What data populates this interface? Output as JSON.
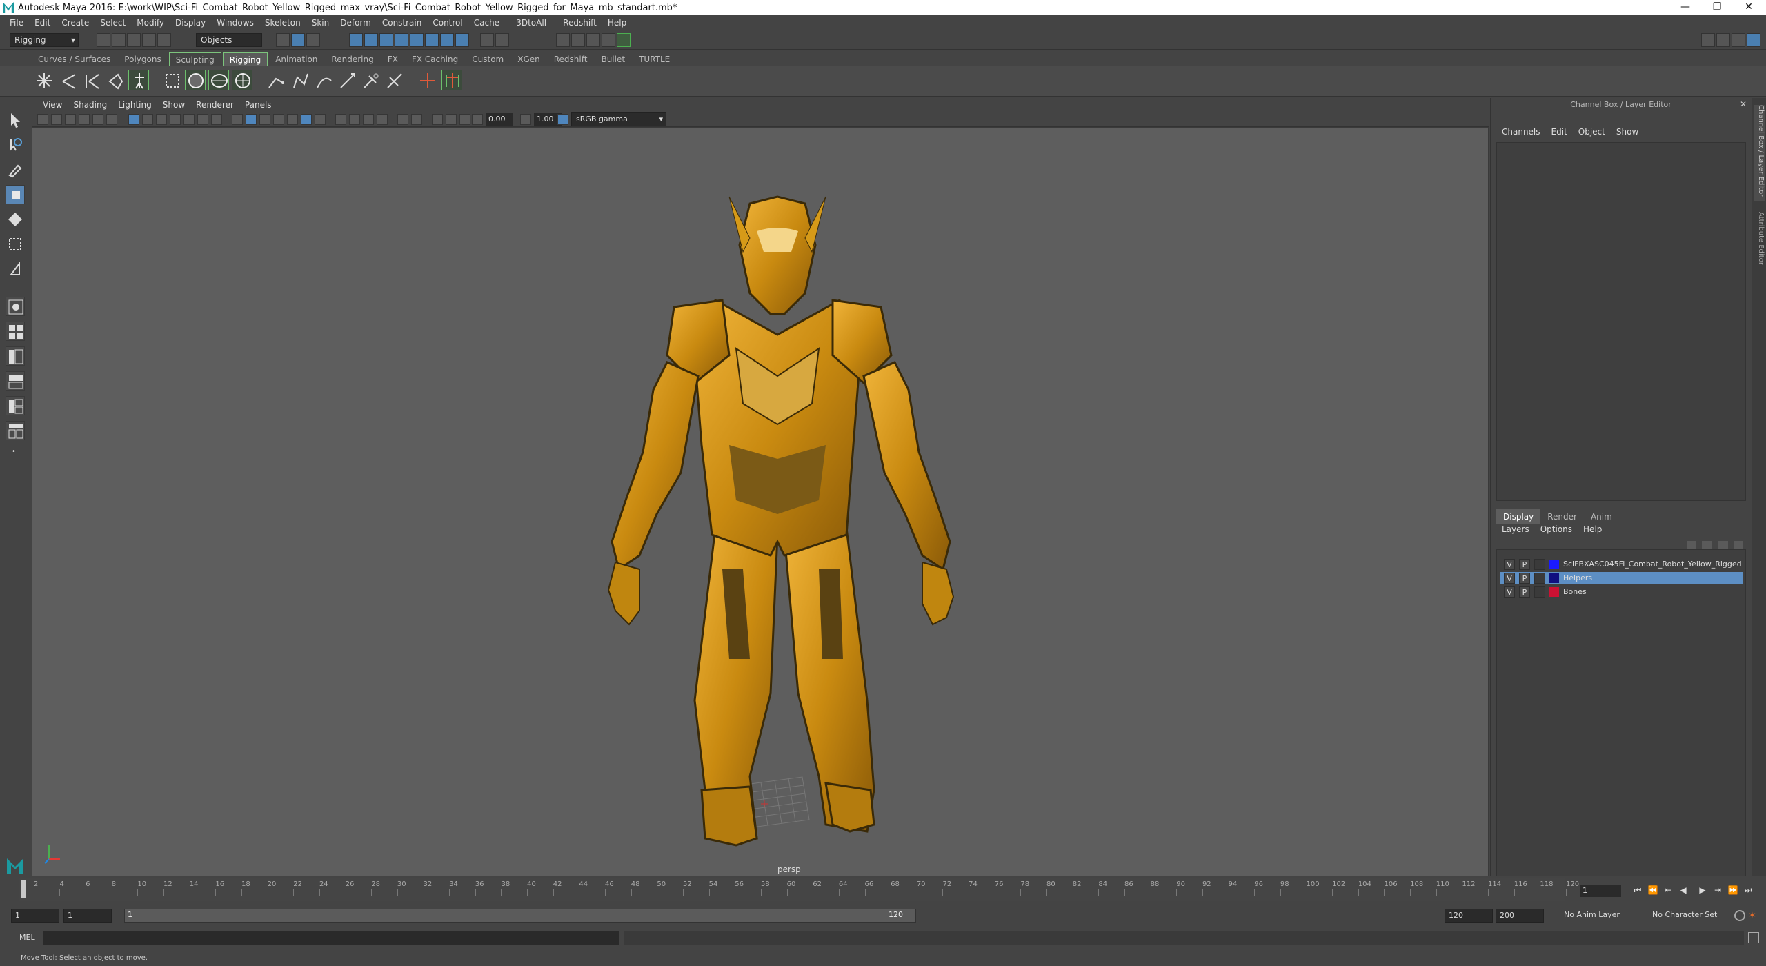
{
  "titlebar": {
    "title": "Autodesk Maya 2016: E:\\work\\WIP\\Sci-Fi_Combat_Robot_Yellow_Rigged_max_vray\\Sci-Fi_Combat_Robot_Yellow_Rigged_for_Maya_mb_standart.mb*",
    "min": "—",
    "restore": "❐",
    "close": "✕"
  },
  "menubar": [
    "File",
    "Edit",
    "Create",
    "Select",
    "Modify",
    "Display",
    "Windows",
    "Skeleton",
    "Skin",
    "Deform",
    "Constrain",
    "Control",
    "Cache",
    "- 3DtoAll -",
    "Redshift",
    "Help"
  ],
  "statusline": {
    "menuset": "Rigging",
    "selmode": "Objects"
  },
  "shelf_tabs": [
    "Curves / Surfaces",
    "Polygons",
    "Sculpting",
    "Rigging",
    "Animation",
    "Rendering",
    "FX",
    "FX Caching",
    "Custom",
    "XGen",
    "Redshift",
    "Bullet",
    "TURTLE"
  ],
  "shelf_selected": "Rigging",
  "viewport": {
    "menu": [
      "View",
      "Shading",
      "Lighting",
      "Show",
      "Renderer",
      "Panels"
    ],
    "exposure": "0.00",
    "gamma": "1.00",
    "colorspace": "sRGB gamma",
    "camera": "persp"
  },
  "channelbox": {
    "title": "Channel Box / Layer Editor",
    "menu": [
      "Channels",
      "Edit",
      "Object",
      "Show"
    ],
    "tabs": [
      "Display",
      "Render",
      "Anim"
    ],
    "selected_tab": "Display",
    "layer_menu": [
      "Layers",
      "Options",
      "Help"
    ],
    "layers": [
      {
        "v": "V",
        "p": "P",
        "name": "SciFBXASC045Fi_Combat_Robot_Yellow_Rigged",
        "color": "#1a1aff",
        "selected": false
      },
      {
        "v": "V",
        "p": "P",
        "name": "Helpers",
        "color": "#101080",
        "selected": true
      },
      {
        "v": "V",
        "p": "P",
        "name": "Bones",
        "color": "#cc1133",
        "selected": false
      }
    ],
    "side_tabs": [
      "Channel Box / Layer Editor",
      "Attribute Editor"
    ]
  },
  "timeline": {
    "ticks": [
      "1",
      "2",
      "4",
      "6",
      "8",
      "10",
      "12",
      "14",
      "16",
      "18",
      "20",
      "22",
      "24",
      "26",
      "28",
      "30",
      "32",
      "34",
      "36",
      "38",
      "40",
      "42",
      "44",
      "46",
      "48",
      "50",
      "52",
      "54",
      "56",
      "58",
      "60",
      "62",
      "64",
      "66",
      "68",
      "70",
      "72",
      "74",
      "76",
      "78",
      "80",
      "82",
      "84",
      "86",
      "88",
      "90",
      "92",
      "94",
      "96",
      "98",
      "100",
      "102",
      "104",
      "106",
      "108",
      "110",
      "112",
      "114",
      "116",
      "118",
      "120"
    ],
    "current": "1"
  },
  "range": {
    "start": "1",
    "anim_start": "1",
    "slider_start": "1",
    "slider_end": "120",
    "anim_end": "120",
    "end": "200",
    "anim_layer": "No Anim Layer",
    "char_set": "No Character Set"
  },
  "cmd": {
    "lang": "MEL"
  },
  "help": "Move Tool: Select an object to move."
}
